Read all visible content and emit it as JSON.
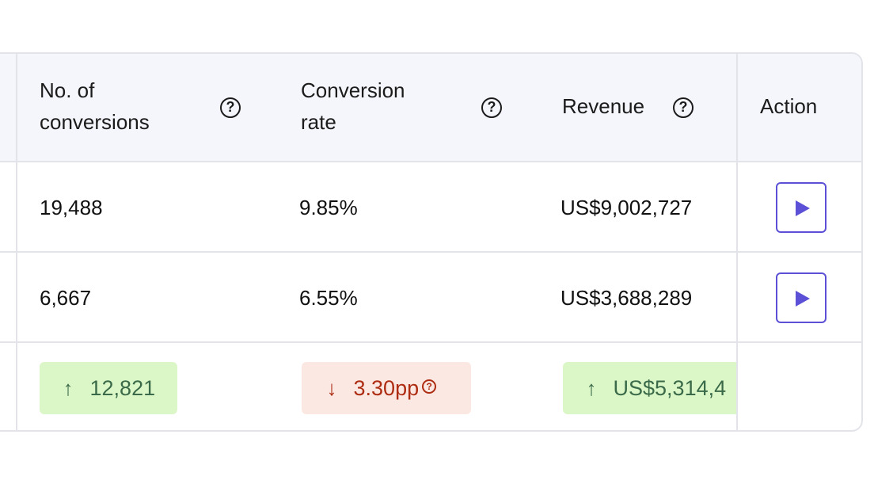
{
  "columns": {
    "conversions": {
      "line1": "No. of",
      "line2": "conversions",
      "help_icon": "question-circle-icon"
    },
    "conversion_rate": {
      "line1": "Conversion",
      "line2": "rate",
      "help_icon": "question-circle-icon"
    },
    "revenue": {
      "label": "Revenue",
      "help_icon": "question-circle-icon"
    },
    "action": {
      "label": "Action"
    }
  },
  "rows": [
    {
      "conversions": "19,488",
      "conversion_rate": "9.85%",
      "revenue": "US$9,002,727",
      "action_icon": "play-icon"
    },
    {
      "conversions": "6,667",
      "conversion_rate": "6.55%",
      "revenue": "US$3,688,289",
      "action_icon": "play-icon"
    }
  ],
  "delta_row": {
    "conversions": {
      "direction": "up",
      "arrow": "↑",
      "value": "12,821"
    },
    "conversion_rate": {
      "direction": "down",
      "arrow": "↓",
      "value": "3.30pp"
    },
    "revenue": {
      "direction": "up",
      "arrow": "↑",
      "value": "US$5,314,4"
    }
  },
  "colors": {
    "accent": "#5b50d6",
    "positive_bg": "#dcf7c7",
    "positive_text": "#3a6a49",
    "negative_bg": "#fbe8e3",
    "negative_text": "#ad2c12"
  }
}
